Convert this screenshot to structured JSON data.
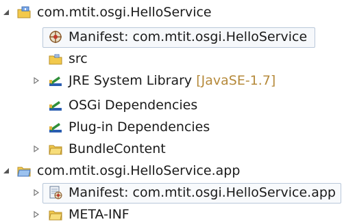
{
  "tree": {
    "items": [
      {
        "label": "com.mtit.osgi.HelloService",
        "expanded": true,
        "icon": "plugin-project-icon"
      },
      {
        "label": "Manifest: com.mtit.osgi.HelloService",
        "icon": "manifest-icon"
      },
      {
        "label": "src",
        "icon": "source-folder-icon"
      },
      {
        "label": "JRE System Library",
        "decoration": "[JavaSE-1.7]",
        "expanded": false,
        "icon": "library-icon"
      },
      {
        "label": "OSGi Dependencies",
        "icon": "library-icon"
      },
      {
        "label": "Plug-in Dependencies",
        "icon": "library-icon"
      },
      {
        "label": "BundleContent",
        "expanded": false,
        "icon": "folder-icon"
      },
      {
        "label": "com.mtit.osgi.HelloService.app",
        "expanded": true,
        "icon": "plugin-project-icon"
      },
      {
        "label": "Manifest: com.mtit.osgi.HelloService.app",
        "expanded": false,
        "icon": "manifest-file-icon"
      },
      {
        "label": "META-INF",
        "expanded": false,
        "icon": "folder-icon"
      }
    ]
  },
  "colors": {
    "decoration": "#b5893a",
    "selection_border": "#b8c7d9",
    "folder": "#f2c94c",
    "library_green": "#2f8f3a",
    "library_blue": "#2a5db0"
  }
}
